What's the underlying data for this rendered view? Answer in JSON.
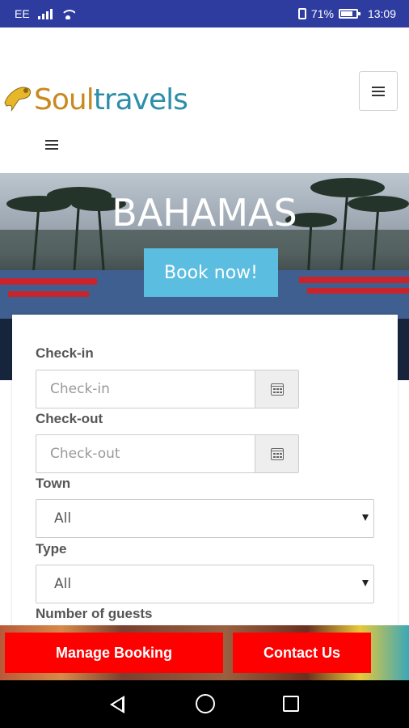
{
  "status_bar": {
    "carrier": "EE",
    "battery_percent": "71%",
    "time": "13:09",
    "icons": [
      "signal-icon",
      "wifi-icon",
      "vibrate-icon",
      "battery-icon"
    ]
  },
  "header": {
    "logo_part1": "Soul",
    "logo_part2": "travels",
    "logo_colors": {
      "soul": "#c9891e",
      "travels": "#2c8ea8"
    },
    "menu_icon": "hamburger-icon"
  },
  "hero": {
    "title": "BAHAMAS",
    "book_button": "Book now!",
    "book_button_color": "#5bbde0"
  },
  "booking_form": {
    "checkin_label": "Check-in",
    "checkin_placeholder": "Check-in",
    "checkout_label": "Check-out",
    "checkout_placeholder": "Check-out",
    "town_label": "Town",
    "town_value": "All",
    "type_label": "Type",
    "type_value": "All",
    "guests_label": "Number of guests"
  },
  "bottom_actions": {
    "manage_booking": "Manage Booking",
    "contact_us": "Contact Us",
    "button_color": "#ff0000"
  },
  "nav_bar": {
    "icons": [
      "back-icon",
      "home-icon",
      "recent-apps-icon"
    ]
  }
}
